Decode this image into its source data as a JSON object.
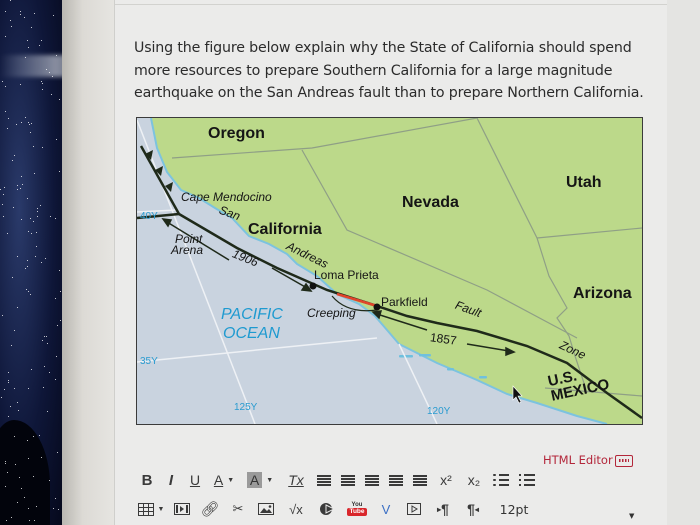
{
  "question": {
    "text": "Using the figure below explain why the State of California should spend more resources to prepare Southern California for a large magnitude earthquake on the San Andreas fault than to prepare Northern California."
  },
  "map": {
    "states": {
      "oregon": "Oregon",
      "nevada": "Nevada",
      "utah": "Utah",
      "california": "California",
      "arizona": "Arizona"
    },
    "places": {
      "cape_mendocino": "Cape Mendocino",
      "point_arena_1": "Point",
      "point_arena_2": "Arena",
      "loma_prieta": "Loma Prieta",
      "parkfield": "Parkfield"
    },
    "fault_words": {
      "san": "San",
      "andreas": "Andreas",
      "fault": "Fault",
      "zone": "Zone",
      "creeping": "Creeping",
      "rupture_1906": "1906",
      "rupture_1857": "1857"
    },
    "ocean": {
      "line1": "PACIFIC",
      "line2": "OCEAN"
    },
    "border": {
      "line1": "U.S.",
      "line2": "MEXICO"
    },
    "coords": {
      "lat_40": "40Y",
      "lat_35": "35Y",
      "lon_125": "125Y",
      "lon_120": "120Y"
    },
    "colors": {
      "land": "#bcd98a",
      "ocean": "#c9d3df",
      "fault": "#1f2a1a",
      "creeping_segment": "#e0452b",
      "coast": "#6fc0de"
    }
  },
  "editor": {
    "html_editor_label": "HTML Editor",
    "toolbar_row1": {
      "bold": "B",
      "italic": "I",
      "underline": "U",
      "text_color": "A",
      "bg_color": "A",
      "clear_format": "Tx",
      "superscript": "x²",
      "subscript": "x₂"
    },
    "toolbar_row2": {
      "math": "√x",
      "youtube_top": "You",
      "youtube_bottom": "Tube",
      "ltr": "¶",
      "rtl": "¶",
      "font_size": "12pt"
    },
    "accent_color": "#b3263a"
  }
}
